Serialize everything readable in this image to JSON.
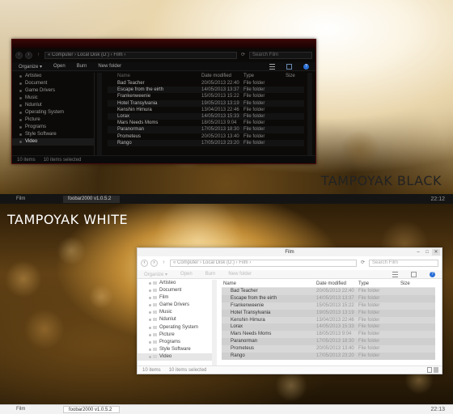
{
  "top_panel": {
    "brand": "TAMPOYAK BLACK",
    "window": {
      "address_segments": "« Computer › Local Disk (D:) › Film ›",
      "search_placeholder": "Search Film",
      "toolbar": [
        "Organize ▾",
        "Open",
        "Burn",
        "New folder"
      ],
      "sidebar": [
        "Artisteo",
        "Document",
        "Game Drivers",
        "Music",
        "Ndunlut",
        "Operating System",
        "Picture",
        "Programs",
        "Style Software",
        "Video"
      ],
      "columns": {
        "name": "Name",
        "date": "Date modified",
        "type": "Type",
        "size": "Size"
      },
      "rows": [
        {
          "name": "Bad Teacher",
          "date": "20/05/2013 22:40",
          "type": "File folder"
        },
        {
          "name": "Escape from the eirth",
          "date": "14/05/2013 13:37",
          "type": "File folder"
        },
        {
          "name": "Frankenweenie",
          "date": "15/05/2013 15:22",
          "type": "File folder"
        },
        {
          "name": "Hotel Transylvania",
          "date": "19/05/2013 13:19",
          "type": "File folder"
        },
        {
          "name": "Kenshin Himura",
          "date": "13/04/2013 22:46",
          "type": "File folder"
        },
        {
          "name": "Lorax",
          "date": "14/05/2013 15:33",
          "type": "File folder"
        },
        {
          "name": "Mars Needs Moms",
          "date": "18/05/2013 9:04",
          "type": "File folder"
        },
        {
          "name": "Paranorman",
          "date": "17/05/2013 18:30",
          "type": "File folder"
        },
        {
          "name": "Prometeus",
          "date": "20/05/2013 13:40",
          "type": "File folder"
        },
        {
          "name": "Rango",
          "date": "17/05/2013 23:20",
          "type": "File folder"
        }
      ],
      "status_count": "10 items",
      "status_selected": "10 items selected"
    },
    "taskbar": {
      "item1": "Film",
      "item2": "foobar2000 v1.0.5.2",
      "clock": "22:12"
    }
  },
  "bottom_panel": {
    "brand": "TAMPOYAK WHITE",
    "window": {
      "title": "Film",
      "address_segments": "« Computer › Local Disk (D:) › Film ›",
      "search_placeholder": "Search Film",
      "toolbar": [
        "Organize ▾",
        "Open",
        "Burn",
        "New folder"
      ],
      "sidebar": [
        "Artisteo",
        "Document",
        "Film",
        "Game Drivers",
        "Music",
        "Ndunlut",
        "Operating System",
        "Picture",
        "Programs",
        "Style Software",
        "Video"
      ],
      "columns": {
        "name": "Name",
        "date": "Date modified",
        "type": "Type",
        "size": "Size"
      },
      "rows": [
        {
          "name": "Bad Teacher",
          "date": "20/05/2013 22:40",
          "type": "File folder"
        },
        {
          "name": "Escape from the eirth",
          "date": "14/05/2013 13:37",
          "type": "File folder"
        },
        {
          "name": "Frankenweenie",
          "date": "15/05/2013 15:22",
          "type": "File folder"
        },
        {
          "name": "Hotel Transylvania",
          "date": "19/05/2013 13:19",
          "type": "File folder"
        },
        {
          "name": "Kenshin Himura",
          "date": "13/04/2013 22:46",
          "type": "File folder"
        },
        {
          "name": "Lorax",
          "date": "14/05/2013 15:33",
          "type": "File folder"
        },
        {
          "name": "Mars Needs Moms",
          "date": "18/05/2013 9:04",
          "type": "File folder"
        },
        {
          "name": "Paranorman",
          "date": "17/05/2013 18:30",
          "type": "File folder"
        },
        {
          "name": "Prometeus",
          "date": "20/05/2013 13:40",
          "type": "File folder"
        },
        {
          "name": "Rango",
          "date": "17/05/2013 23:20",
          "type": "File folder"
        }
      ],
      "status_count": "10 items",
      "status_selected": "10 items selected"
    },
    "taskbar": {
      "item1": "Film",
      "item2": "foobar2000 v1.0.5.2",
      "clock": "22:13"
    }
  },
  "colors": {
    "black_accent": "#4a0a0a",
    "white_selection": "#d8d8d8",
    "help_blue": "#2a6fd6"
  },
  "icons": [
    "back-arrow-icon",
    "forward-arrow-icon",
    "up-arrow-icon",
    "refresh-icon",
    "search-icon",
    "view-options-icon",
    "preview-pane-icon",
    "help-icon",
    "minimize-icon",
    "maximize-icon",
    "close-icon",
    "folder-icon"
  ]
}
